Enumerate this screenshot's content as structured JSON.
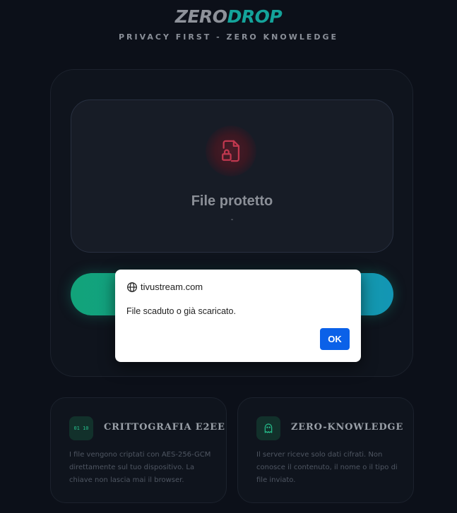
{
  "header": {
    "logo_part1": "ZERO",
    "logo_part2": "DROP",
    "tagline": "PRIVACY FIRST - ZERO KNOWLEDGE"
  },
  "file_card": {
    "icon": "file-lock-icon",
    "title": "File protetto",
    "subtitle": "-"
  },
  "features": [
    {
      "icon": "binary-icon",
      "icon_text": "01 10",
      "title": "CRITTOGRAFIA E2EE",
      "description": "I file vengono criptati con AES-256-GCM direttamente sul tuo dispositivo. La chiave non lascia mai il browser."
    },
    {
      "icon": "ghost-icon",
      "title": "ZERO-KNOWLEDGE",
      "description": "Il server riceve solo dati cifrati. Non conosce il contenuto, il nome o il tipo di file inviato."
    }
  ],
  "dialog": {
    "origin": "tivustream.com",
    "message": "File scaduto o già scaricato.",
    "ok_label": "OK"
  },
  "colors": {
    "background": "#0c1019",
    "accent_green": "#12a37a",
    "accent_blue": "#1396b5",
    "lock_red": "#c0384f",
    "dialog_button": "#0b61e8"
  }
}
